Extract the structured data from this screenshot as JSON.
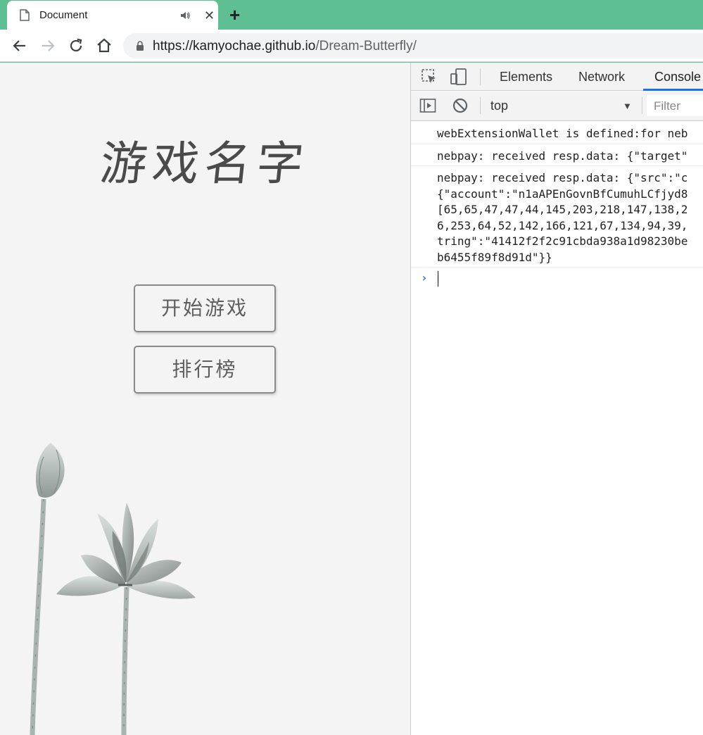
{
  "browser": {
    "tab_title": "Document",
    "url_host": "https://kamyochae.github.io",
    "url_path": "/Dream-Butterfly/",
    "colors": {
      "frame": "#5ebf93",
      "toolbar": "#ffffff"
    },
    "icons": {
      "favicon": "document-icon",
      "audio": "speaker-icon",
      "close": "close-icon",
      "new_tab": "plus-icon",
      "back": "back-arrow-icon",
      "forward": "forward-arrow-icon",
      "reload": "reload-icon",
      "home": "home-icon",
      "lock": "lock-icon"
    },
    "glyphs": {
      "close": "✕",
      "new_tab": "+"
    }
  },
  "game": {
    "title": "游戏名字",
    "start_button": "开始游戏",
    "leaderboard_button": "排行榜"
  },
  "devtools": {
    "tabs": [
      "Elements",
      "Network",
      "Console"
    ],
    "active_tab": "Console",
    "context": "top",
    "filter_placeholder": "Filter",
    "icons": [
      "inspect-element-icon",
      "device-toolbar-icon",
      "sidebar-toggle-icon",
      "clear-console-icon"
    ],
    "logs": [
      "webExtensionWallet is defined:for neb",
      "nebpay: received resp.data: {\"target\"",
      "nebpay: received resp.data: {\"src\":\"c\n{\"account\":\"n1aAPEnGovnBfCumuhLCfjyd8\n[65,65,47,47,44,145,203,218,147,138,2\n6,253,64,52,142,166,121,67,134,94,39,\ntring\":\"41412f2f2c91cbda938a1d98230be\nb6455f89f8d91d\"}}"
    ],
    "prompt": "›"
  }
}
